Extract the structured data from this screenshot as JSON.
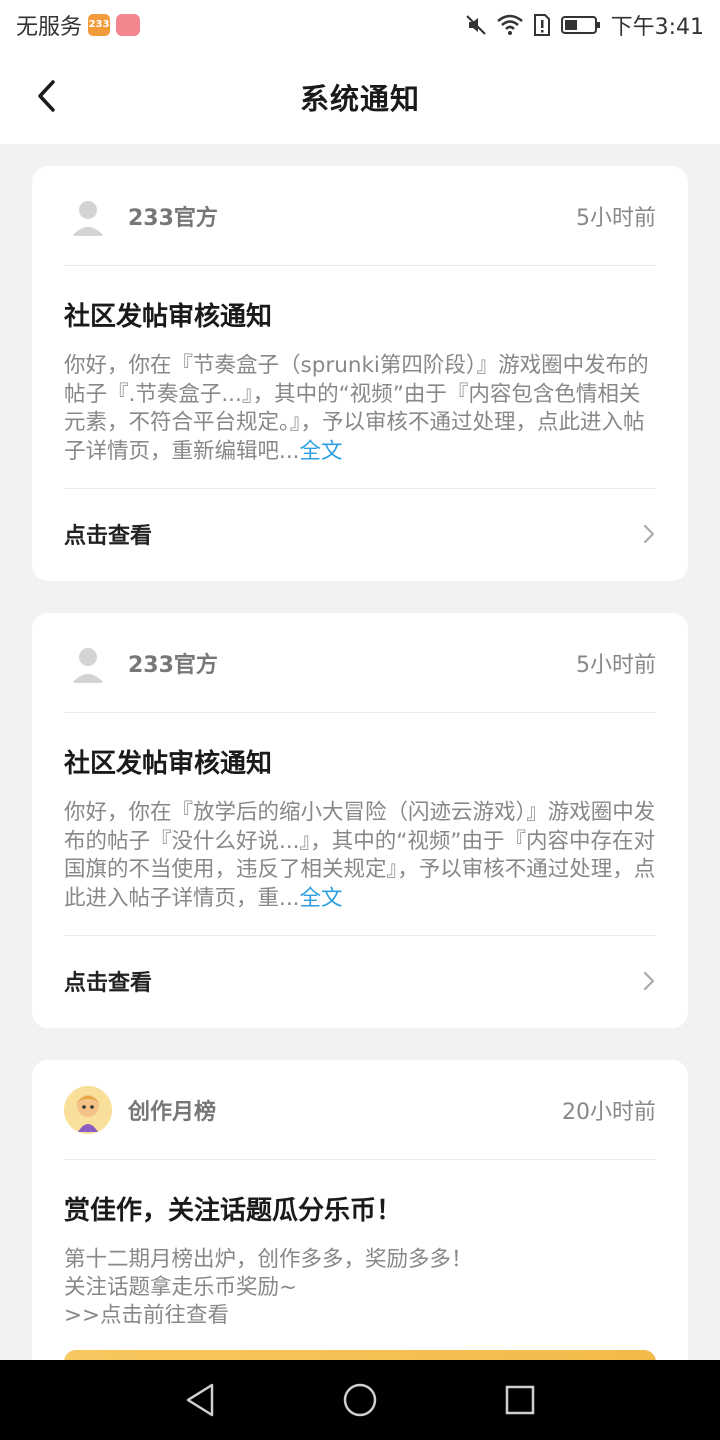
{
  "status_bar": {
    "carrier": "无服务",
    "badge_233": "233",
    "time": "下午3:41"
  },
  "header": {
    "title": "系统通知",
    "back_icon": "chevron-left-icon"
  },
  "notifications": [
    {
      "sender": "233官方",
      "time": "5小时前",
      "title": "社区发帖审核通知",
      "body": "你好，你在『节奏盒子（sprunki第四阶段）』游戏圈中发布的帖子『.节奏盒子...』，其中的“视频”由于『内容包含色情相关元素，不符合平台规定。』，予以审核不通过处理，点此进入帖子详情页，重新编辑吧...",
      "full_text_link": "全文",
      "action_label": "点击查看"
    },
    {
      "sender": "233官方",
      "time": "5小时前",
      "title": "社区发帖审核通知",
      "body": "你好，你在『放学后的缩小大冒险（闪迹云游戏）』游戏圈中发布的帖子『没什么好说...』，其中的“视频”由于『内容中存在对国旗的不当使用，违反了相关规定』，予以审核不通过处理，点此进入帖子详情页，重...",
      "full_text_link": "全文",
      "action_label": "点击查看"
    },
    {
      "sender": "创作月榜",
      "time": "20小时前",
      "title": "赏佳作，关注话题瓜分乐币！",
      "body_lines": [
        "第十二期月榜出炉，创作多多，奖励多多！",
        "关注话题拿走乐币奖励~",
        ">>点击前往查看"
      ]
    }
  ],
  "colors": {
    "link": "#2d9fe0",
    "background": "#f2f2f2",
    "banner": "#f7c860"
  }
}
